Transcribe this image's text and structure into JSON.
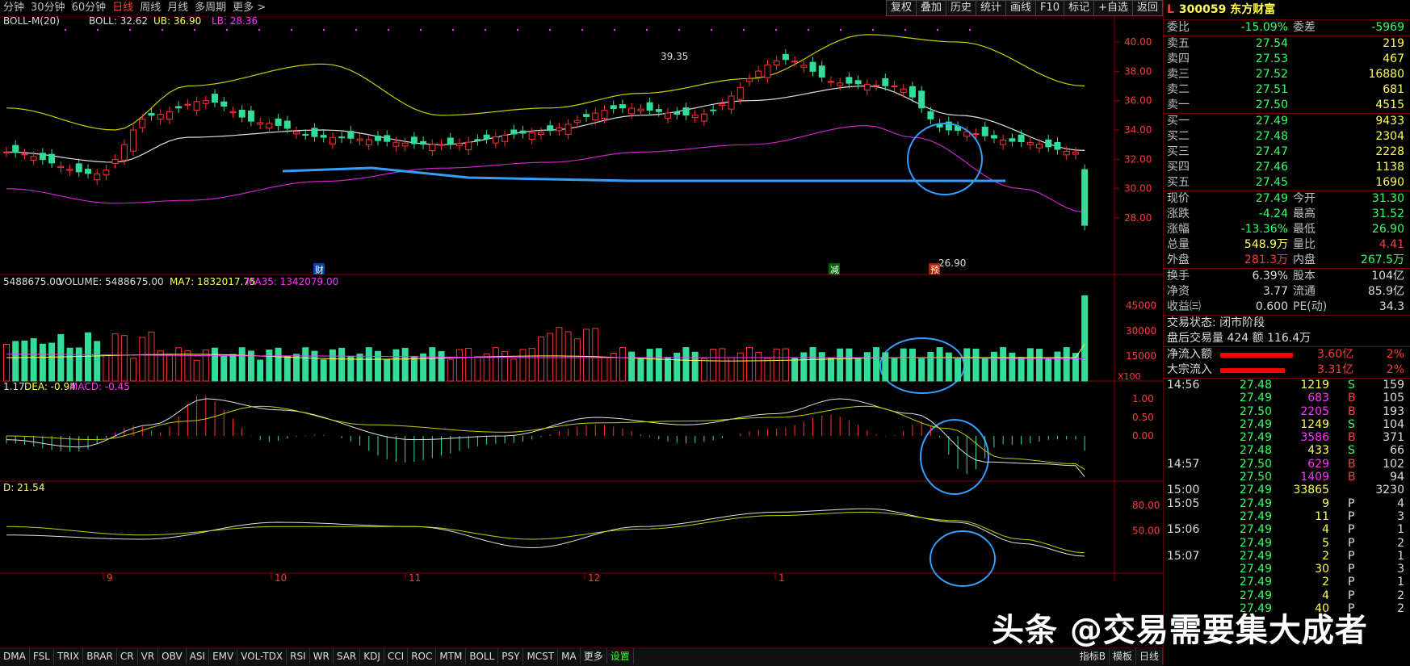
{
  "toolbar": {
    "timeframes": [
      "分钟",
      "30分钟",
      "60分钟",
      "日线",
      "周线",
      "月线",
      "多周期",
      "更多 >"
    ],
    "active_timeframe": "日线",
    "buttons": [
      "复权",
      "叠加",
      "历史",
      "统计",
      "画线",
      "F10",
      "标记",
      "+自选",
      "返回"
    ]
  },
  "price_panel": {
    "indicator": "BOLL-M(20)",
    "boll": "BOLL: 32.62",
    "ub": "UB: 36.90",
    "lb": "LB: 28.36",
    "axis_labels": [
      "40.00",
      "38.00",
      "36.00",
      "34.00",
      "32.00",
      "30.00",
      "28.00"
    ],
    "high_label": "39.35",
    "low_label": "26.90",
    "markers": [
      "财",
      "减",
      "预"
    ]
  },
  "volume_panel": {
    "lead": "5488675.00",
    "volume": "VOLUME: 5488675.00",
    "ma7": "MA7: 1832017.75",
    "ma35": "MA35: 1342079.00",
    "axis_labels": [
      "45000",
      "30000",
      "15000"
    ],
    "unit": "X100"
  },
  "macd_panel": {
    "lead": "1.17",
    "dea": "DEA: -0.94",
    "macd": "MACD: -0.45",
    "axis_labels": [
      "1.00",
      "0.50",
      "0.00"
    ]
  },
  "kdj_panel": {
    "lead": "D: 21.54",
    "axis_labels": [
      "80.00",
      "50.00"
    ]
  },
  "x_axis": [
    "9",
    "10",
    "11",
    "12",
    "1"
  ],
  "bottom": {
    "tabs": [
      "DMA",
      "FSL",
      "TRIX",
      "BRAR",
      "CR",
      "VR",
      "OBV",
      "ASI",
      "EMV",
      "VOL-TDX",
      "RSI",
      "WR",
      "SAR",
      "KDJ",
      "CCI",
      "ROC",
      "MTM",
      "BOLL",
      "PSY",
      "MCST",
      "MA",
      "更多",
      "设置"
    ],
    "active": "设置",
    "right": [
      "指标B",
      "模板",
      "日线"
    ]
  },
  "quote": {
    "code": "300059",
    "name": "东方财富",
    "weibi_label": "委比",
    "weibi": "-15.09%",
    "weicha_label": "委差",
    "weicha": "-5969",
    "asks": [
      {
        "label": "卖五",
        "price": "27.54",
        "vol": "219"
      },
      {
        "label": "卖四",
        "price": "27.53",
        "vol": "467"
      },
      {
        "label": "卖三",
        "price": "27.52",
        "vol": "16880"
      },
      {
        "label": "卖二",
        "price": "27.51",
        "vol": "681"
      },
      {
        "label": "卖一",
        "price": "27.50",
        "vol": "4515"
      }
    ],
    "bids": [
      {
        "label": "买一",
        "price": "27.49",
        "vol": "9433"
      },
      {
        "label": "买二",
        "price": "27.48",
        "vol": "2304"
      },
      {
        "label": "买三",
        "price": "27.47",
        "vol": "2228"
      },
      {
        "label": "买四",
        "price": "27.46",
        "vol": "1138"
      },
      {
        "label": "买五",
        "price": "27.45",
        "vol": "1690"
      }
    ],
    "stats": [
      {
        "l1": "现价",
        "v1": "27.49",
        "l2": "今开",
        "v2": "31.30",
        "c1": "grn",
        "c2": "grn"
      },
      {
        "l1": "涨跌",
        "v1": "-4.24",
        "l2": "最高",
        "v2": "31.52",
        "c1": "grn",
        "c2": "grn"
      },
      {
        "l1": "涨幅",
        "v1": "-13.36%",
        "l2": "最低",
        "v2": "26.90",
        "c1": "grn",
        "c2": "grn"
      },
      {
        "l1": "总量",
        "v1": "548.9万",
        "l2": "量比",
        "v2": "4.41",
        "c1": "yel",
        "c2": "red"
      },
      {
        "l1": "外盘",
        "v1": "281.3万",
        "l2": "内盘",
        "v2": "267.5万",
        "c1": "red",
        "c2": "grn"
      }
    ],
    "stats2": [
      {
        "l1": "换手",
        "v1": "6.39%",
        "l2": "股本",
        "v2": "104亿"
      },
      {
        "l1": "净资",
        "v1": "3.77",
        "l2": "流通",
        "v2": "85.9亿"
      },
      {
        "l1": "收益㈢",
        "v1": "0.600",
        "l2": "PE(动)",
        "v2": "34.3"
      }
    ],
    "trade_status": "交易状态: 闭市阶段",
    "after_hours": "盘后交易量 424 额 116.4万",
    "flows": [
      {
        "label": "净流入额",
        "value": "3.60亿",
        "pct": "2%"
      },
      {
        "label": "大宗流入",
        "value": "3.31亿",
        "pct": "2%"
      }
    ],
    "ticks": [
      {
        "t": "14:56",
        "p": "27.48",
        "v": "1219",
        "s": "S",
        "n": "159"
      },
      {
        "t": "",
        "p": "27.49",
        "v": "683",
        "s": "B",
        "n": "105"
      },
      {
        "t": "",
        "p": "27.50",
        "v": "2205",
        "s": "B",
        "n": "193"
      },
      {
        "t": "",
        "p": "27.49",
        "v": "1249",
        "s": "S",
        "n": "104"
      },
      {
        "t": "",
        "p": "27.49",
        "v": "3586",
        "s": "B",
        "n": "371"
      },
      {
        "t": "",
        "p": "27.48",
        "v": "433",
        "s": "S",
        "n": "66"
      },
      {
        "t": "14:57",
        "p": "27.50",
        "v": "629",
        "s": "B",
        "n": "102"
      },
      {
        "t": "",
        "p": "27.50",
        "v": "1409",
        "s": "B",
        "n": "94"
      },
      {
        "t": "15:00",
        "p": "27.49",
        "v": "33865",
        "s": "",
        "n": "3230"
      },
      {
        "t": "15:05",
        "p": "27.49",
        "v": "9",
        "s": "P",
        "n": "4"
      },
      {
        "t": "",
        "p": "27.49",
        "v": "11",
        "s": "P",
        "n": "3"
      },
      {
        "t": "15:06",
        "p": "27.49",
        "v": "4",
        "s": "P",
        "n": "1"
      },
      {
        "t": "",
        "p": "27.49",
        "v": "5",
        "s": "P",
        "n": "2"
      },
      {
        "t": "15:07",
        "p": "27.49",
        "v": "2",
        "s": "P",
        "n": "1"
      },
      {
        "t": "",
        "p": "27.49",
        "v": "30",
        "s": "P",
        "n": "3"
      },
      {
        "t": "",
        "p": "27.49",
        "v": "2",
        "s": "P",
        "n": "1"
      },
      {
        "t": "",
        "p": "27.49",
        "v": "4",
        "s": "P",
        "n": "2"
      },
      {
        "t": "",
        "p": "27.49",
        "v": "40",
        "s": "P",
        "n": "2"
      }
    ]
  },
  "watermark": "头条 @交易需要集大成者"
}
